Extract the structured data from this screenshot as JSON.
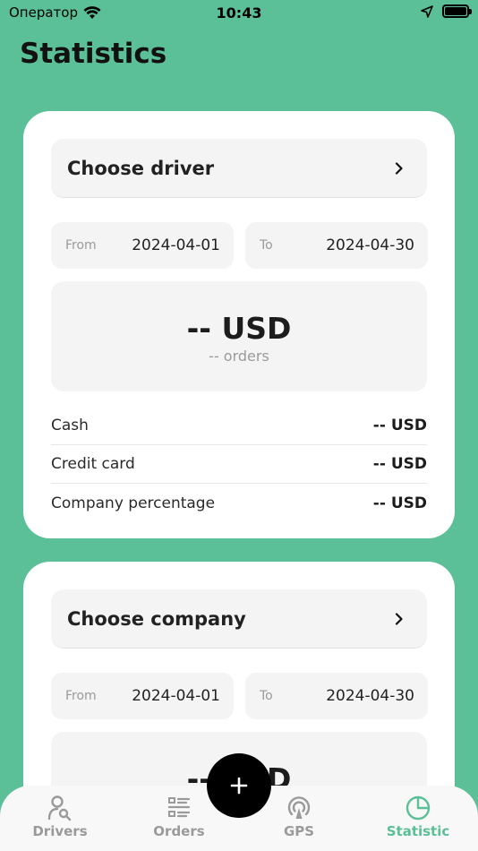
{
  "status_bar": {
    "carrier": "Оператор",
    "time": "10:43"
  },
  "page": {
    "title": "Statistics"
  },
  "driver_card": {
    "chooser_label": "Choose driver",
    "from_label": "From",
    "from_value": "2024-04-01",
    "to_label": "To",
    "to_value": "2024-04-30",
    "total_amount": "-- USD",
    "total_orders": "-- orders",
    "rows": [
      {
        "label": "Cash",
        "value": "-- USD"
      },
      {
        "label": "Credit card",
        "value": "-- USD"
      },
      {
        "label": "Company percentage",
        "value": "-- USD"
      }
    ]
  },
  "company_card": {
    "chooser_label": "Choose company",
    "from_label": "From",
    "from_value": "2024-04-01",
    "to_label": "To",
    "to_value": "2024-04-30",
    "total_amount": "-- USD"
  },
  "tabs": [
    {
      "label": "Drivers",
      "icon": "driver-search-icon"
    },
    {
      "label": "Orders",
      "icon": "list-icon"
    },
    {
      "label": "GPS",
      "icon": "gps-signal-icon"
    },
    {
      "label": "Statistic",
      "icon": "pie-chart-icon"
    }
  ],
  "colors": {
    "background": "#5bbf98",
    "accent": "#5bbf98",
    "card": "#ffffff",
    "field": "#f4f4f4",
    "fab": "#000000"
  },
  "fab": {
    "icon": "plus-icon"
  }
}
